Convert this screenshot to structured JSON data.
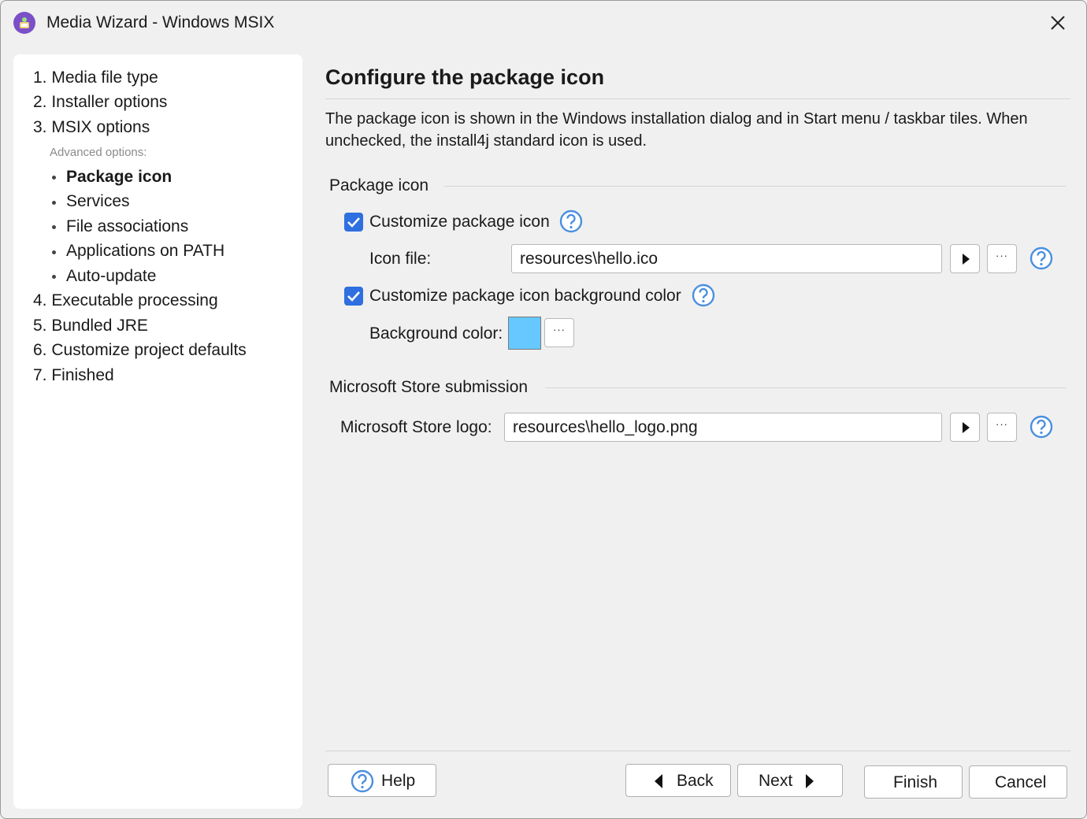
{
  "window": {
    "title": "Media Wizard - Windows MSIX"
  },
  "nav": {
    "items": [
      {
        "label": "1. Media file type"
      },
      {
        "label": "2. Installer options"
      },
      {
        "label": "3. MSIX options"
      }
    ],
    "advanced_label": "Advanced options:",
    "sub_items": [
      {
        "label": "Package icon",
        "active": true
      },
      {
        "label": "Services"
      },
      {
        "label": "File associations"
      },
      {
        "label": "Applications on PATH"
      },
      {
        "label": "Auto-update"
      }
    ],
    "items_after": [
      {
        "label": "4. Executable processing"
      },
      {
        "label": "5. Bundled JRE"
      },
      {
        "label": "6. Customize project defaults"
      },
      {
        "label": "7. Finished"
      }
    ]
  },
  "main": {
    "heading": "Configure the package icon",
    "description": "The package icon is shown in the Windows installation dialog and in Start menu / taskbar tiles. When unchecked, the install4j standard icon is used.",
    "package_icon_section": {
      "title": "Package icon",
      "customize_icon": {
        "label": "Customize package icon",
        "checked": true
      },
      "icon_file": {
        "label": "Icon file:",
        "value": "resources\\hello.ico"
      },
      "customize_bg": {
        "label": "Customize package icon background color",
        "checked": true
      },
      "background_color": {
        "label": "Background color:",
        "value": "#66c8ff"
      }
    },
    "store_section": {
      "title": "Microsoft Store submission",
      "logo": {
        "label": "Microsoft Store logo:",
        "value": "resources\\hello_logo.png"
      }
    },
    "browse_button_text": "···"
  },
  "buttons": {
    "help": "Help",
    "back": "Back",
    "next": "Next",
    "finish": "Finish",
    "cancel": "Cancel"
  },
  "colors": {
    "accent": "#2f6fdf",
    "help_icon": "#4a8fe0",
    "app_icon": "#7b4fc8"
  }
}
